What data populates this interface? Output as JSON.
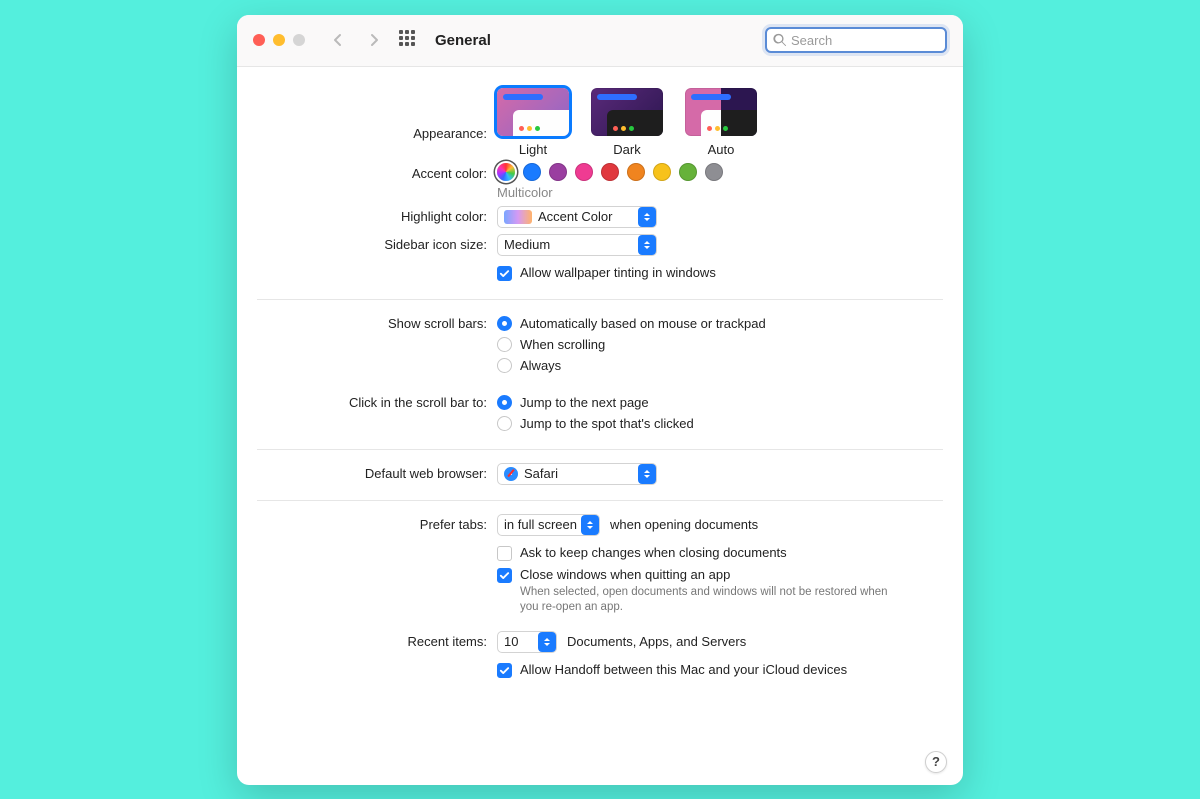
{
  "window": {
    "title": "General"
  },
  "search": {
    "placeholder": "Search",
    "value": ""
  },
  "appearance": {
    "label": "Appearance:",
    "options": [
      {
        "id": "light",
        "caption": "Light",
        "selected": true
      },
      {
        "id": "dark",
        "caption": "Dark",
        "selected": false
      },
      {
        "id": "auto",
        "caption": "Auto",
        "selected": false
      }
    ]
  },
  "accent": {
    "label": "Accent color:",
    "selected_hint": "Multicolor",
    "swatches": [
      {
        "name": "multicolor",
        "color": "multi",
        "selected": true
      },
      {
        "name": "blue",
        "color": "#1a7bff"
      },
      {
        "name": "purple",
        "color": "#9a3ea0"
      },
      {
        "name": "pink",
        "color": "#ef3b92"
      },
      {
        "name": "red",
        "color": "#e0383e"
      },
      {
        "name": "orange",
        "color": "#f0841f"
      },
      {
        "name": "yellow",
        "color": "#f7c21b"
      },
      {
        "name": "green",
        "color": "#66b23a"
      },
      {
        "name": "graphite",
        "color": "#8e8e93"
      }
    ]
  },
  "highlight": {
    "label": "Highlight color:",
    "value": "Accent Color"
  },
  "sidebar_icon": {
    "label": "Sidebar icon size:",
    "value": "Medium"
  },
  "wallpaper_tint": {
    "label": "Allow wallpaper tinting in windows",
    "checked": true
  },
  "scrollbars": {
    "label": "Show scroll bars:",
    "options": [
      {
        "label": "Automatically based on mouse or trackpad",
        "checked": true
      },
      {
        "label": "When scrolling",
        "checked": false
      },
      {
        "label": "Always",
        "checked": false
      }
    ]
  },
  "click_scroll": {
    "label": "Click in the scroll bar to:",
    "options": [
      {
        "label": "Jump to the next page",
        "checked": true
      },
      {
        "label": "Jump to the spot that's clicked",
        "checked": false
      }
    ]
  },
  "browser": {
    "label": "Default web browser:",
    "value": "Safari"
  },
  "tabs": {
    "label": "Prefer tabs:",
    "value": "in full screen",
    "suffix": "when opening documents"
  },
  "ask_keep": {
    "label": "Ask to keep changes when closing documents",
    "checked": false
  },
  "close_windows": {
    "label": "Close windows when quitting an app",
    "checked": true,
    "sub": "When selected, open documents and windows will not be restored when you re-open an app."
  },
  "recent": {
    "label": "Recent items:",
    "value": "10",
    "suffix": "Documents, Apps, and Servers"
  },
  "handoff": {
    "label": "Allow Handoff between this Mac and your iCloud devices",
    "checked": true
  },
  "help": "?"
}
